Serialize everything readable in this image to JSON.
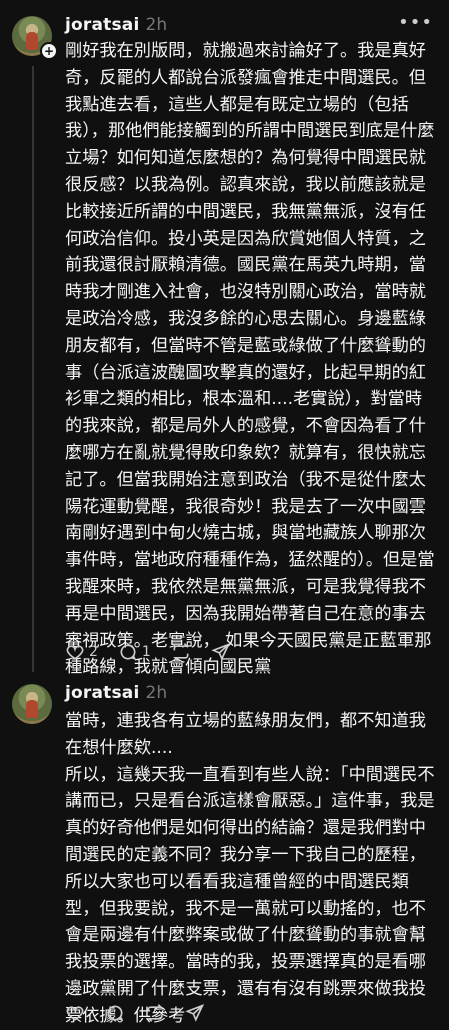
{
  "posts": [
    {
      "username": "joratsai",
      "time": "2h",
      "more_icon": "more-horizontal-icon",
      "text": "剛好我在別版問，就搬過來討論好了。我是真好奇，反罷的人都說台派發瘋會推走中間選民。但我點進去看，這些人都是有既定立場的（包括我），那他們能接觸到的所謂中間選民到底是什麼立場？如何知道怎麼想的？為何覺得中間選民就很反感？以我為例。認真來說，我以前應該就是比較接近所謂的中間選民，我無黨無派，沒有任何政治信仰。投小英是因為欣賞她個人特質，之前我還很討厭賴清德。國民黨在馬英九時期，當時我才剛進入社會，也沒特別關心政治，當時就是政治冷感，我沒多餘的心思去關心。身邊藍綠朋友都有，但當時不管是藍或綠做了什麼聳動的事（台派這波醜圖攻擊真的還好，比起早期的紅衫軍之類的相比，根本溫和....老實說），對當時的我來說，都是局外人的感覺，不會因為看了什麼哪方在亂就覺得敗印象欸？就算有，很快就忘記了。但當我開始注意到政治（我不是從什麼太陽花運動覺醒，我很奇妙！我是去了一次中國雲南剛好遇到中甸火燒古城，與當地藏族人聊那次事件時，當地政府種種作為，猛然醒的）。但是當我醒來時，我依然是無黨無派，可是我覺得我不再是中間選民，因為我開始帶著自己在意的事去審視政策。老實說， 如果今天國民黨是正藍軍那種路線，我就會傾向國民黨",
      "likes": "2",
      "replies": "1"
    },
    {
      "username": "joratsai",
      "time": "2h",
      "text": "當時，連我各有立場的藍綠朋友們，都不知道我在想什麼欸....\n所以，這幾天我一直看到有些人說：「中間選民不講而已，只是看台派這樣會厭惡。」這件事，我是真的好奇他們是如何得出的結論？還是我們對中間選民的定義不同？我分享一下我自己的歷程，所以大家也可以看看我這種曾經的中間選民類型，但我要說，我不是一萬就可以動搖的，也不會是兩邊有什麼弊案或做了什麼聳動的事就會幫我投票的選擇。當時的我，投票選擇真的是看哪邊政黨開了什麼支票，還有有沒有跳票來做我投票依據。供參考"
    }
  ],
  "icons": {
    "avatar": "avatar-image",
    "follow": "plus-icon",
    "like": "heart-icon",
    "reply": "comment-icon",
    "repost": "repost-icon",
    "share": "share-icon"
  },
  "colors": {
    "background": "#101010",
    "text": "#f3f5f7",
    "muted": "#777777",
    "thread_line": "#333638"
  }
}
